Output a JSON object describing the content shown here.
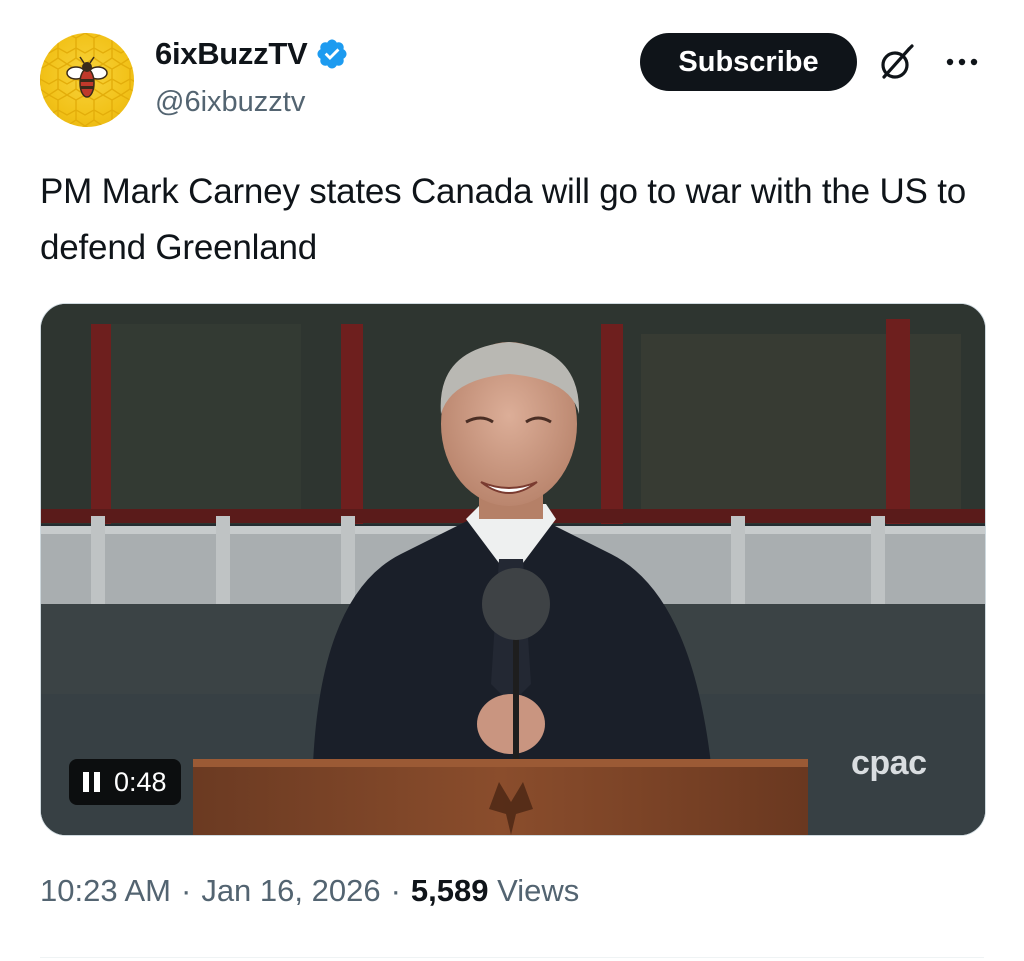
{
  "author": {
    "display_name": "6ixBuzzTV",
    "handle": "@6ixbuzztv",
    "verified": true,
    "verified_color": "#1d9bf0"
  },
  "actions": {
    "subscribe_label": "Subscribe"
  },
  "tweet": {
    "text": "PM Mark Carney states Canada will go to war with the US to defend Greenland"
  },
  "video": {
    "time": "0:48",
    "watermark": "cpac",
    "state": "playing"
  },
  "meta": {
    "time": "10:23 AM",
    "separator": "·",
    "date": "Jan 16, 2026",
    "views_count": "5,589",
    "views_label": "Views"
  },
  "colors": {
    "text_primary": "#0f1419",
    "text_secondary": "#536471",
    "avatar_yellow": "#f2c219"
  },
  "icons": [
    "honeycomb-bee-avatar",
    "verified-badge-icon",
    "grok-icon",
    "more-icon",
    "pause-icon"
  ]
}
